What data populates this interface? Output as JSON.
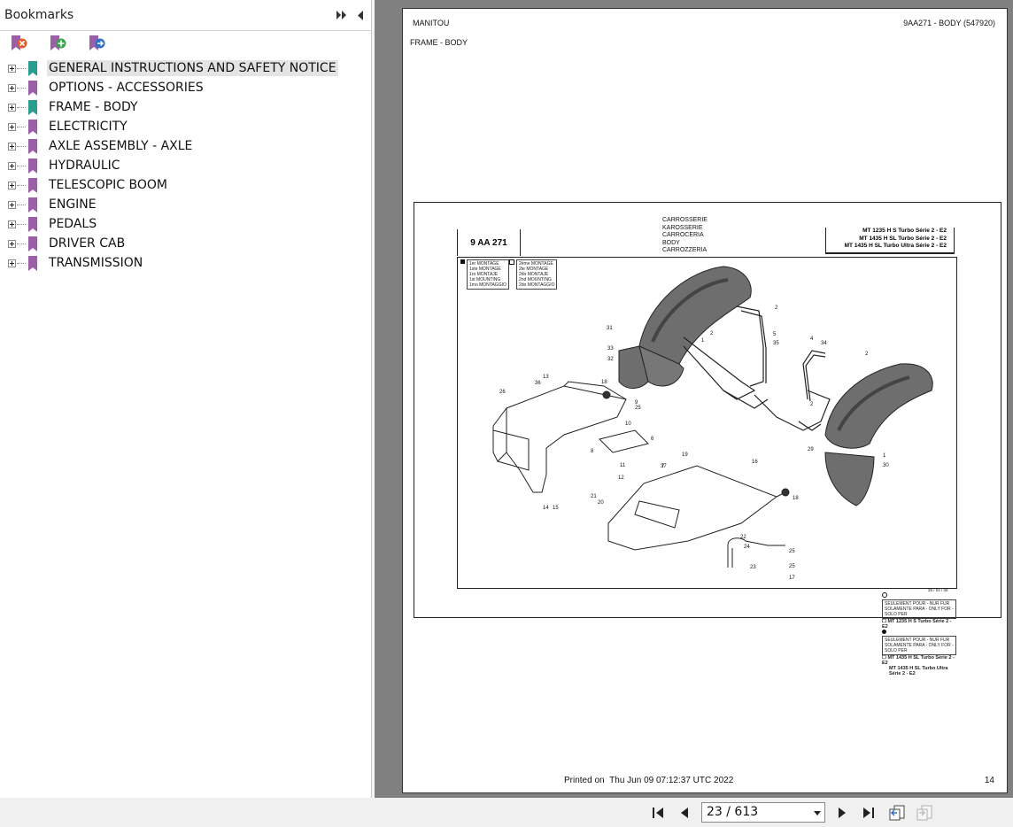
{
  "sidebar": {
    "title": "Bookmarks",
    "toolbar": [
      {
        "name": "delete-bookmark-icon",
        "color": "#e05a2b"
      },
      {
        "name": "add-bookmark-icon",
        "color": "#3aa24a"
      },
      {
        "name": "goto-bookmark-icon",
        "color": "#2d72c4"
      }
    ],
    "items": [
      {
        "label": "GENERAL INSTRUCTIONS AND SAFETY NOTICE",
        "color": "#2a9d8f",
        "selected": true
      },
      {
        "label": "OPTIONS - ACCESSORIES",
        "color": "#9b5fa8"
      },
      {
        "label": "FRAME - BODY",
        "color": "#2a9d8f"
      },
      {
        "label": "ELECTRICITY",
        "color": "#9b5fa8"
      },
      {
        "label": "AXLE ASSEMBLY - AXLE",
        "color": "#9b5fa8"
      },
      {
        "label": "HYDRAULIC",
        "color": "#9b5fa8"
      },
      {
        "label": "TELESCOPIC BOOM",
        "color": "#9b5fa8"
      },
      {
        "label": "ENGINE",
        "color": "#9b5fa8"
      },
      {
        "label": "PEDALS",
        "color": "#9b5fa8"
      },
      {
        "label": "DRIVER CAB",
        "color": "#9b5fa8"
      },
      {
        "label": "TRANSMISSION",
        "color": "#9b5fa8"
      }
    ]
  },
  "page": {
    "header_left": "MANITOU",
    "header_right": "9AA271 - BODY (547920)",
    "subtitle": "FRAME - BODY",
    "drawing": {
      "code": "9 AA 271",
      "titles": [
        "CARROSSERIE",
        "KAROSSERIE",
        "CARROCERIA",
        "BODY",
        "CARROZZERIA"
      ],
      "models": [
        "MT 1235 H S Turbo Série 2 - E2",
        "MT 1435 H SL Turbo Série 2 - E2",
        "MT 1435 H SL Turbo Ultra Série 2 - E2"
      ],
      "legend_first": [
        "1er MONTAGE",
        "1ste MONTAGE",
        "1ro MONTAJE",
        "1st MOUNTING",
        "1mo MONTAGGIO"
      ],
      "legend_second": [
        "2ème MONTAGE",
        "2te MONTAGE",
        "2do MONTAJE",
        "2nd MOUNTING",
        "2do MONTAGGIO"
      ],
      "note_a": "SEULEMENT POUR - NUR FUR",
      "note_b": "SOLAMENTE PARA - ONLY FOR - SOLO PER",
      "note_model_1": "MT 1235 H S Turbo Série 2 - E2",
      "note_c": "SEULEMENT POUR - NUR FUR",
      "note_d": "SOLAMENTE PARA - ONLY FOR - SOLO PER",
      "note_model_2": "MT 1435 H SL Turbo Série 2 - E2",
      "note_model_3": "MT 1435 H SL Turbo Ultra Série 2 - E2",
      "date": "28 / 04 / 08",
      "part_numbers": [
        "2",
        "31",
        "1",
        "2",
        "5",
        "35",
        "4",
        "34",
        "2",
        "33",
        "32",
        "13",
        "18",
        "36",
        "26",
        "9",
        "25",
        "10",
        "6",
        "8",
        "11",
        "12",
        "7",
        "2",
        "29",
        "1",
        "30",
        "19",
        "16",
        "37",
        "18",
        "21",
        "20",
        "14",
        "15",
        "22",
        "24",
        "23",
        "25",
        "25",
        "17"
      ]
    },
    "printed_label": "Printed on",
    "printed_date": "Thu Jun 09 07:12:37 UTC 2022",
    "page_number": "14"
  },
  "navigation": {
    "page_indicator": "23 / 613"
  }
}
